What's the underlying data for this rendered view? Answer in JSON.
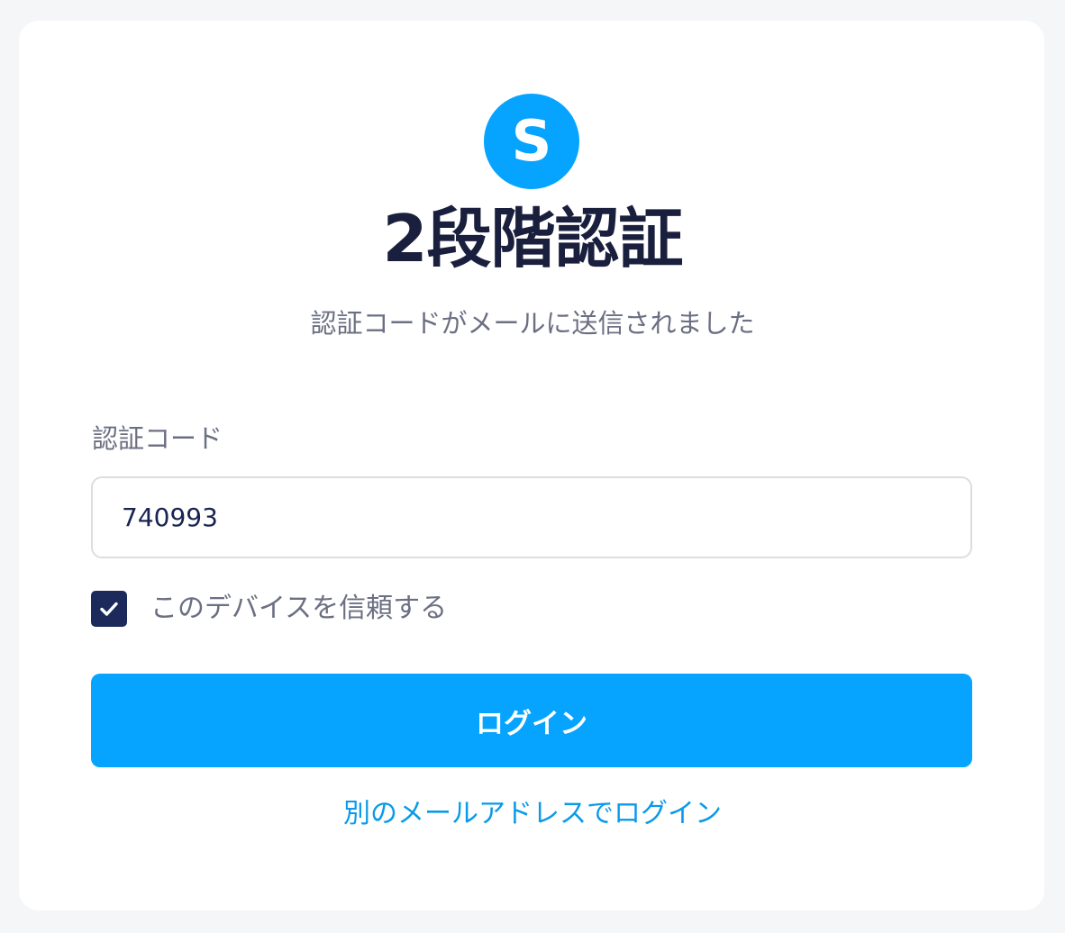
{
  "logo": {
    "letter": "S",
    "color": "#06a4ff"
  },
  "heading": {
    "title": "2段階認証",
    "subtitle": "認証コードがメールに送信されました"
  },
  "form": {
    "code_label": "認証コード",
    "code_value": "740993",
    "trust_device_checked": true,
    "trust_device_label": "このデバイスを信頼する",
    "login_button_label": "ログイン",
    "alt_login_link": "別のメールアドレスでログイン"
  },
  "colors": {
    "accent": "#06a4ff",
    "checkbox": "#1b2a5a",
    "title_text": "#1a1f3d",
    "muted_text": "#6b6f82",
    "link": "#0a9ae8"
  },
  "icons": {
    "checkbox": "check-icon"
  }
}
